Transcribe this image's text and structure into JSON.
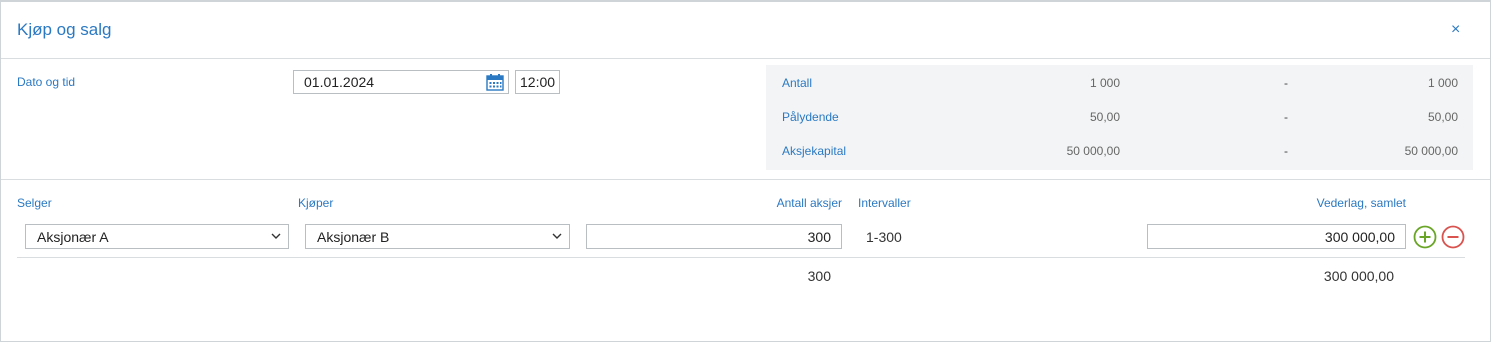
{
  "dialog": {
    "title": "Kjøp og salg",
    "close_glyph": "×"
  },
  "datetime": {
    "label": "Dato og tid",
    "date": "01.01.2024",
    "time": "12:00",
    "calendar_icon": "calendar-icon"
  },
  "summary": {
    "rows": [
      {
        "label": "Antall",
        "before": "1 000",
        "dash": "-",
        "after": "1 000"
      },
      {
        "label": "Pålydende",
        "before": "50,00",
        "dash": "-",
        "after": "50,00"
      },
      {
        "label": "Aksjekapital",
        "before": "50 000,00",
        "dash": "-",
        "after": "50 000,00"
      }
    ]
  },
  "transaction": {
    "headers": {
      "seller": "Selger",
      "buyer": "Kjøper",
      "shares": "Antall aksjer",
      "intervals": "Intervaller",
      "consideration": "Vederlag, samlet"
    },
    "row": {
      "seller": "Aksjonær A",
      "buyer": "Aksjonær B",
      "shares": "300",
      "intervals": "1-300",
      "consideration": "300 000,00"
    },
    "totals": {
      "shares": "300",
      "consideration": "300 000,00"
    },
    "icons": {
      "add": "plus-circle-icon",
      "remove": "minus-circle-icon"
    },
    "colors": {
      "add": "#6aa527",
      "remove": "#d9534f",
      "accent": "#2b79c2"
    }
  }
}
